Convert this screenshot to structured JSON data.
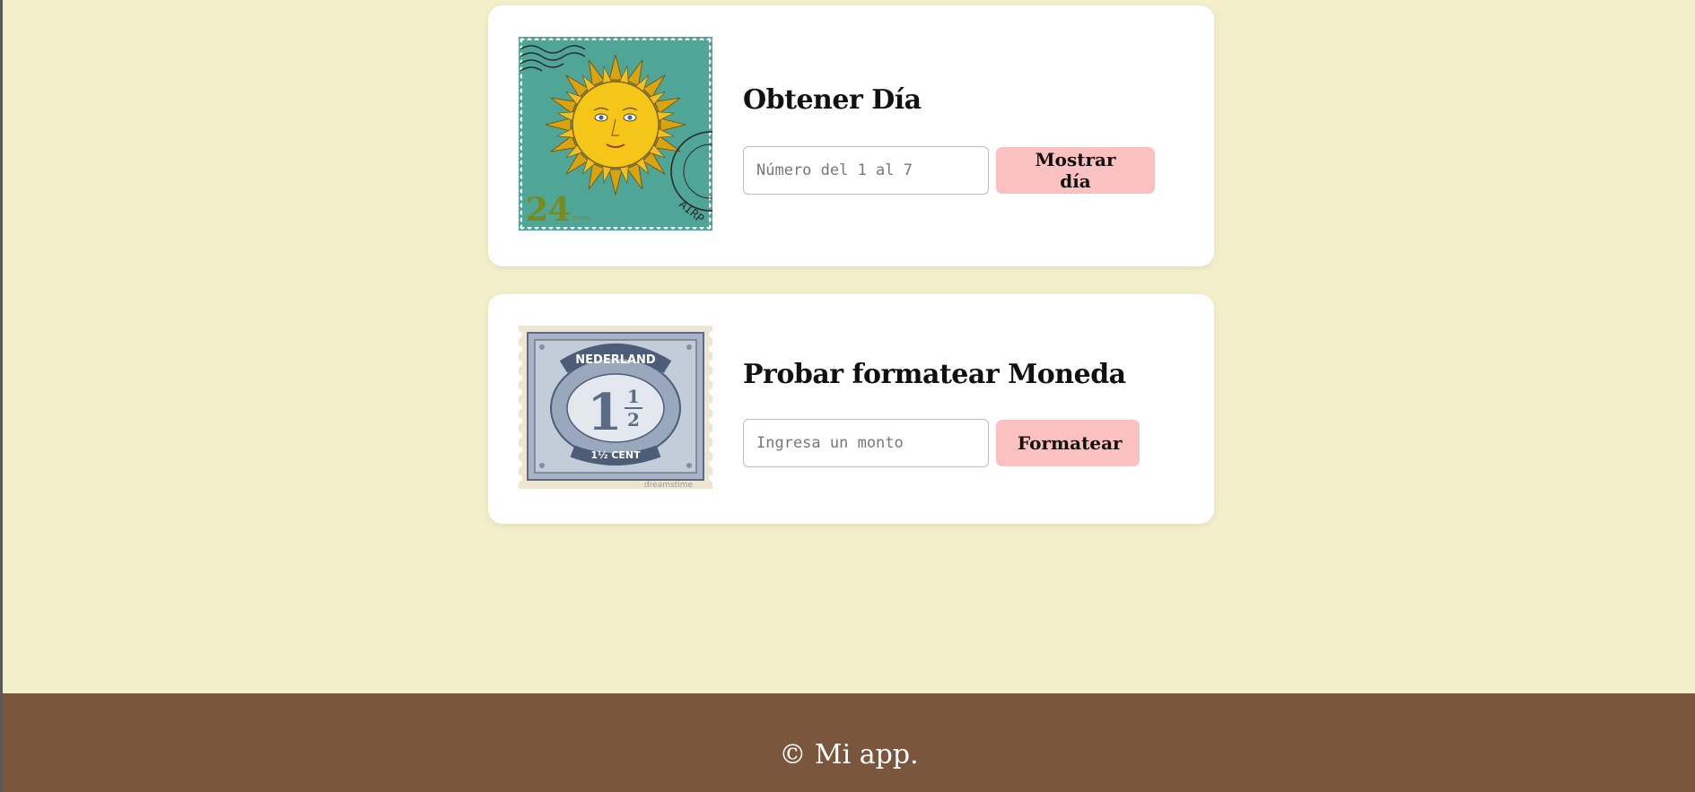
{
  "cards": [
    {
      "title": "Obtener Día",
      "input_placeholder": "Número del 1 al 7",
      "input_value": "",
      "button_label": "Mostrar día",
      "stamp": {
        "icon": "sun-stamp-icon",
        "value_text": "24",
        "postmark_text": "AIRP",
        "background_color": "#4fa596",
        "sun_color": "#f5c518"
      }
    },
    {
      "title": "Probar formatear Moneda",
      "input_placeholder": "Ingresa un monto",
      "input_value": "",
      "button_label": "Formatear",
      "stamp": {
        "icon": "nederland-stamp-icon",
        "country_text": "NEDERLAND",
        "value_text": "1½ CENT",
        "big_numeral": "1",
        "fraction_top": "1",
        "fraction_bottom": "2",
        "watermark_text": "dreamstime",
        "ink_color": "#7a8aa3"
      }
    }
  ],
  "footer": {
    "text": "© Mi app."
  },
  "colors": {
    "page_background": "#f4efcb",
    "card_background": "#ffffff",
    "button_background": "#fbc0c0",
    "footer_background": "#7a563c"
  }
}
